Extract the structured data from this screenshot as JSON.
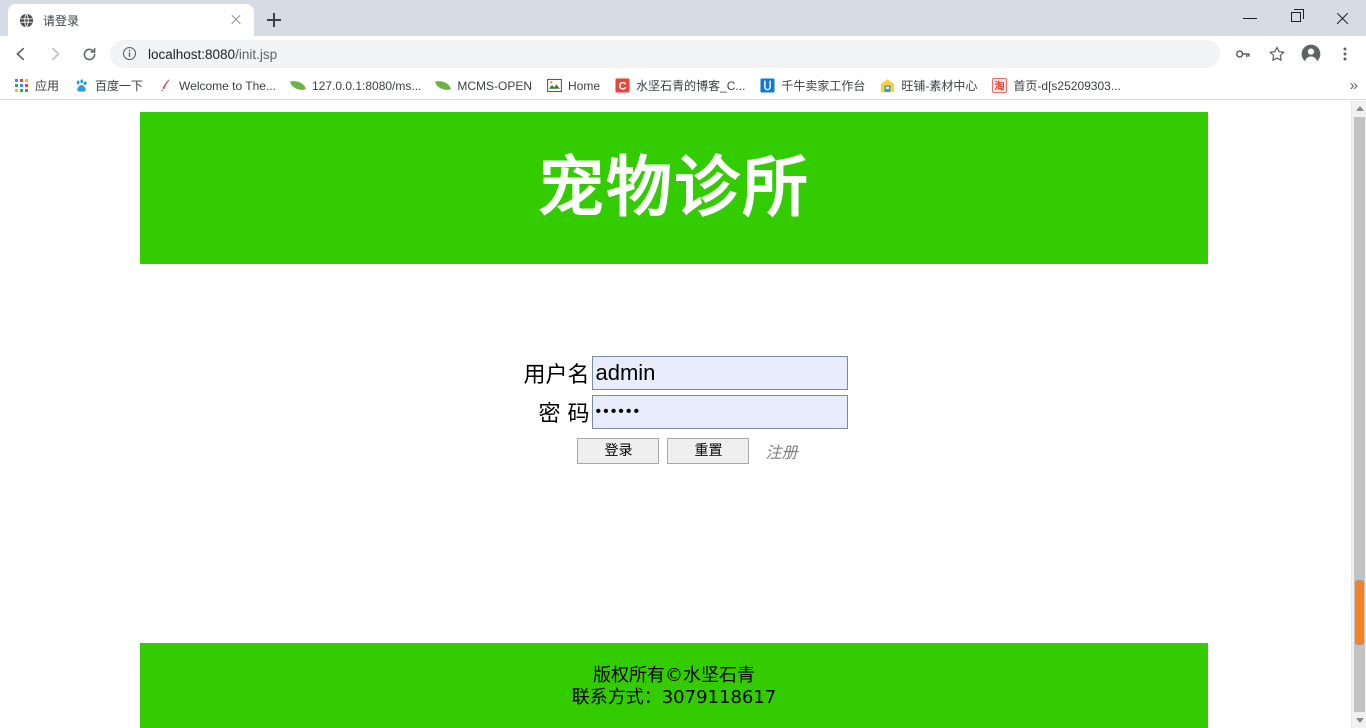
{
  "browser": {
    "tab": {
      "title": "请登录",
      "favicon": "globe-icon",
      "close_label": "×"
    },
    "new_tab_label": "+",
    "window_controls": {
      "minimize": "minimize-icon",
      "maximize": "maximize-icon",
      "close": "close-icon"
    },
    "toolbar": {
      "back": "back-arrow-icon",
      "forward": "forward-arrow-icon",
      "reload": "reload-icon",
      "url_main": "localhost:8080",
      "url_path": "/init.jsp",
      "info_icon": "info-circle-icon",
      "password_icon": "key-icon",
      "bookmark_icon": "star-icon",
      "profile_icon": "avatar-icon",
      "menu_icon": "three-dot-menu-icon"
    },
    "bookmarks": {
      "overflow_label": "»",
      "items": [
        {
          "label": "应用",
          "icon": "apps-grid-icon"
        },
        {
          "label": "百度一下",
          "icon": "baidu-paw-icon"
        },
        {
          "label": "Welcome to The...",
          "icon": "apache-feather-icon"
        },
        {
          "label": "127.0.0.1:8080/ms...",
          "icon": "spring-leaf-icon"
        },
        {
          "label": "MCMS-OPEN",
          "icon": "spring-leaf-icon"
        },
        {
          "label": "Home",
          "icon": "image-icon"
        },
        {
          "label": "水坚石青的博客_C...",
          "icon": "csdn-icon"
        },
        {
          "label": "千牛卖家工作台",
          "icon": "qianniu-icon"
        },
        {
          "label": "旺铺-素材中心",
          "icon": "wangpu-icon"
        },
        {
          "label": "首页-d[s25209303...",
          "icon": "taobao-icon"
        }
      ]
    }
  },
  "page": {
    "banner": {
      "title": "宠物诊所",
      "background_color": "#33cc00"
    },
    "login": {
      "username_label": "用户名",
      "username_value": "admin",
      "username_placeholder": "",
      "password_label": "密 码",
      "password_value": "••••••",
      "password_placeholder": "",
      "login_button": "登录",
      "reset_button": "重置",
      "register_link": "注册"
    },
    "footer": {
      "copyright": "版权所有©水坚石青",
      "contact": "联系方式：3079118617",
      "background_color": "#33cc00"
    }
  },
  "scrollbar": {
    "up_arrow": "scroll-up-arrow",
    "down_arrow": "scroll-down-arrow",
    "thumb_color": "#f5821f"
  }
}
